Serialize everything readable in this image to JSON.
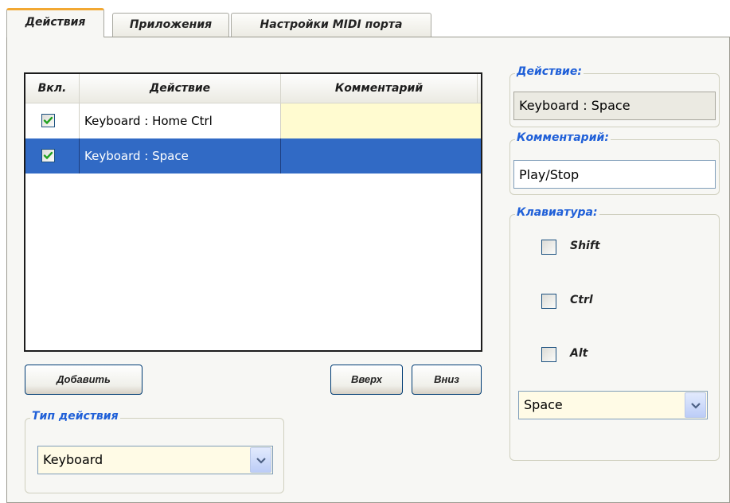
{
  "tabs": [
    {
      "label": "Действия",
      "active": true
    },
    {
      "label": "Приложения",
      "active": false
    },
    {
      "label": "Настройки MIDI порта",
      "active": false
    }
  ],
  "list": {
    "columns": [
      "Вкл.",
      "Действие",
      "Комментарий"
    ],
    "rows": [
      {
        "enabled": true,
        "action": "Keyboard : Home  Ctrl",
        "comment": "",
        "selected": false
      },
      {
        "enabled": true,
        "action": "Keyboard : Space",
        "comment": "",
        "selected": true
      }
    ]
  },
  "buttons": {
    "add": "Добавить",
    "up": "Вверх",
    "down": "Вниз"
  },
  "action_type": {
    "title": "Тип действия",
    "value": "Keyboard"
  },
  "details": {
    "action_title": "Действие:",
    "action_value": "Keyboard : Space",
    "comment_title": "Комментарий:",
    "comment_value": "Play/Stop",
    "keyboard_title": "Клавиатура:",
    "modifiers": [
      {
        "label": "Shift",
        "checked": false
      },
      {
        "label": "Ctrl",
        "checked": false
      },
      {
        "label": "Alt",
        "checked": false
      }
    ],
    "key_value": "Space"
  },
  "colors": {
    "selection": "#316ac5",
    "row_highlight": "#fffbd0",
    "group_title": "#2060d8",
    "tab_accent": "#f2a833",
    "check": "#21a121"
  },
  "icons": {
    "check": "checkmark-icon",
    "dropdown": "chevron-down-icon"
  }
}
